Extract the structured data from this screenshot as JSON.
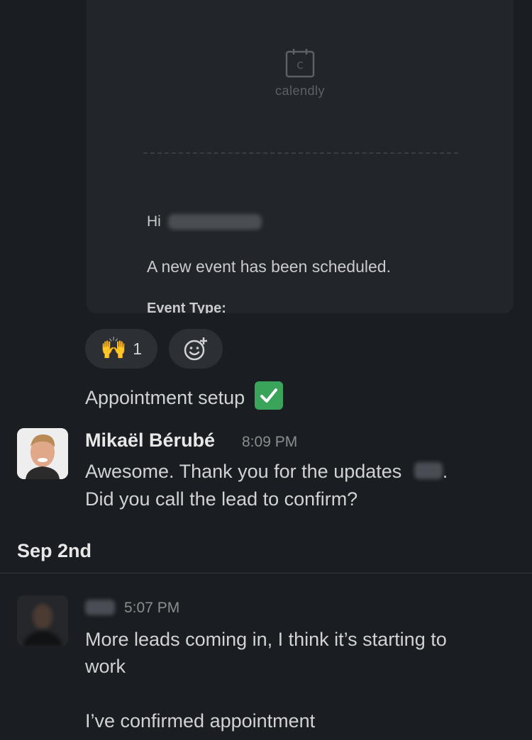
{
  "email": {
    "logo_text": "calendly",
    "greeting": "Hi",
    "body": "A new event has been scheduled.",
    "event_type_label": "Event Type:"
  },
  "reactions": {
    "emoji": "🙌",
    "count": "1"
  },
  "messages": [
    {
      "text": "Appointment setup"
    },
    {
      "sender": "Mikaël Bérubé",
      "time": "8:09 PM",
      "line1": "Awesome. Thank you for the updates",
      "line1_end": ".",
      "line2": "Did you call the lead to confirm?"
    }
  ],
  "date_separator": "Sep 2nd",
  "message3": {
    "time": "5:07 PM",
    "line1": "More leads coming in, I think it’s starting to",
    "line2": "work",
    "line3": "I’ve confirmed appointment"
  },
  "icons": {
    "logo": "calendar-icon",
    "add_reaction": "add-emoji-icon",
    "check": "check-mark-icon"
  },
  "colors": {
    "background": "#1a1d21",
    "card": "#222529",
    "check_green": "#3aa55a"
  }
}
